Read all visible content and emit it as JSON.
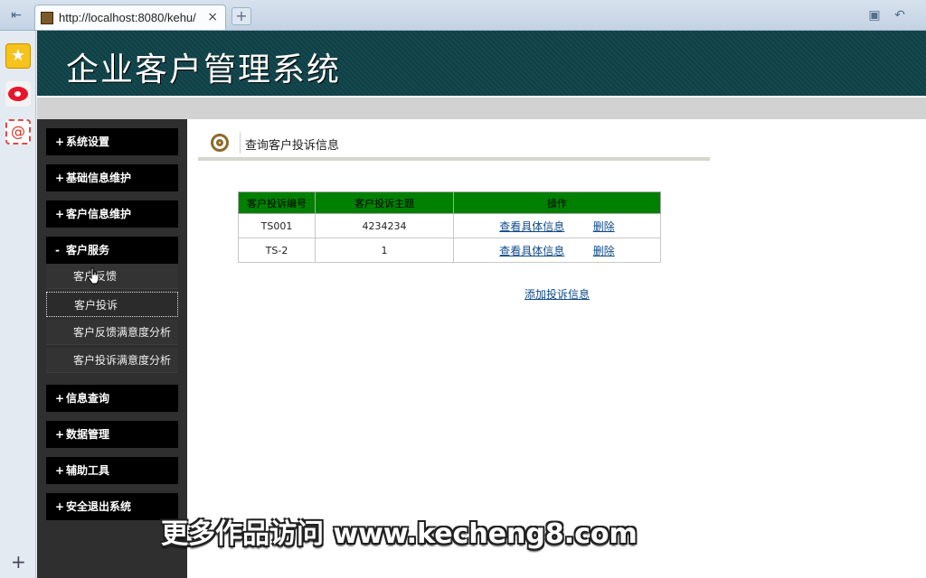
{
  "browser": {
    "tab_title": "http://localhost:8080/kehu/",
    "tab_close": "×",
    "new_tab": "+"
  },
  "header": {
    "title": "企业客户管理系统"
  },
  "sidebar": {
    "items": [
      {
        "sign": "+",
        "label": "系统设置"
      },
      {
        "sign": "+",
        "label": "基础信息维护"
      },
      {
        "sign": "+",
        "label": "客户信息维护"
      },
      {
        "sign": "-",
        "label": "客户服务"
      },
      {
        "sign": "+",
        "label": "信息查询"
      },
      {
        "sign": "+",
        "label": "数据管理"
      },
      {
        "sign": "+",
        "label": "辅助工具"
      },
      {
        "sign": "+",
        "label": "安全退出系统"
      }
    ],
    "sub_items": [
      "客户反馈",
      "客户投诉",
      "客户反馈满意度分析",
      "客户投诉满意度分析"
    ]
  },
  "main": {
    "section_title": "查询客户投诉信息",
    "table": {
      "headers": [
        "客户投诉编号",
        "客户投诉主题",
        "操作"
      ],
      "rows": [
        {
          "id": "TS001",
          "topic": "4234234"
        },
        {
          "id": "TS-2",
          "topic": "1"
        }
      ],
      "view_label": "查看具体信息",
      "delete_label": "删除"
    },
    "add_link": "添加投诉信息"
  },
  "watermark": "更多作品访问 www.kecheng8.com",
  "colors": {
    "banner": "#0e4147",
    "table_header": "#008000",
    "link": "#0f4a8a"
  }
}
